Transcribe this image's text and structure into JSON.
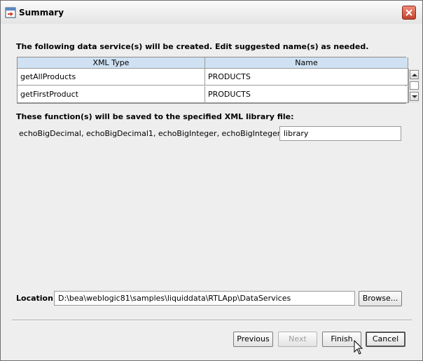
{
  "window": {
    "title": "Summary"
  },
  "services": {
    "heading": "The following data service(s) will be created.  Edit suggested name(s) as needed.",
    "columns": [
      "XML Type",
      "Name"
    ],
    "rows": [
      {
        "xml_type": "getAllProducts",
        "name": "PRODUCTS"
      },
      {
        "xml_type": "getFirstProduct",
        "name": "PRODUCTS"
      }
    ]
  },
  "functions": {
    "heading": "These function(s) will be saved to the specified XML library file:",
    "list": "echoBigDecimal, echoBigDecimal1, echoBigInteger, echoBigInteger1, echo...",
    "library_value": "library"
  },
  "location": {
    "label": "Location",
    "value": "D:\\bea\\weblogic81\\samples\\liquiddata\\RTLApp\\DataServices",
    "browse_label": "Browse..."
  },
  "buttons": {
    "previous": "Previous",
    "next": "Next",
    "finish": "Finish",
    "cancel": "Cancel"
  }
}
